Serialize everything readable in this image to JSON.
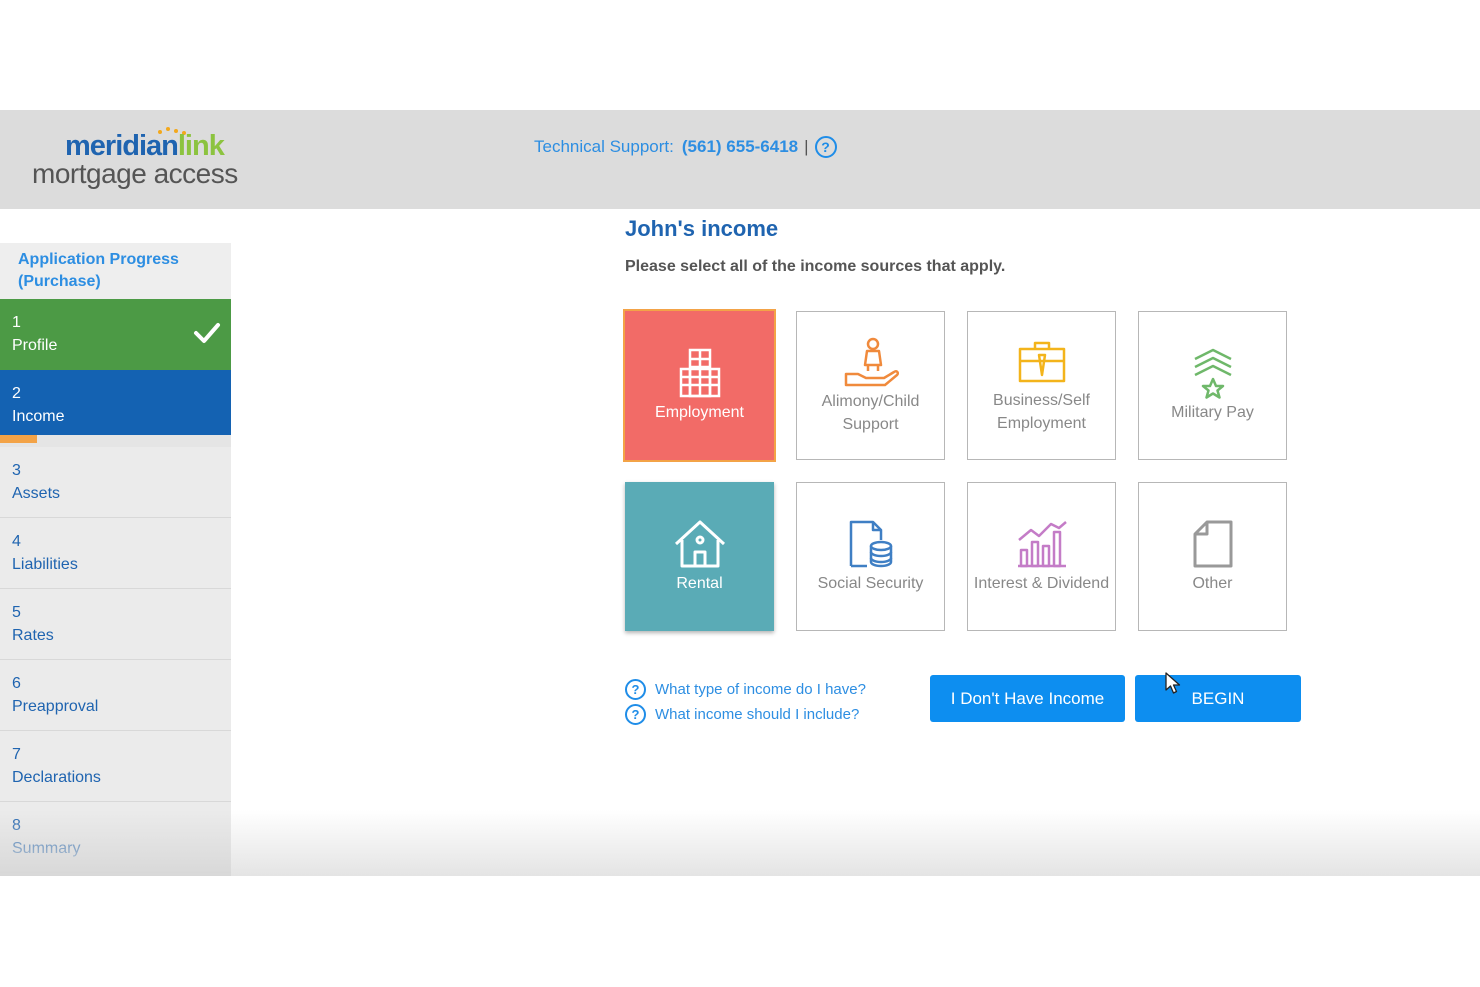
{
  "header": {
    "logo_primary_a": "meridian",
    "logo_primary_b": "link",
    "logo_secondary": "mortgage access",
    "support_label": "Technical Support:",
    "support_phone": "(561) 655-6418",
    "support_separator": "|",
    "help_icon": "question-circle-icon"
  },
  "sidebar": {
    "heading": "Application Progress (Purchase)",
    "steps": [
      {
        "num": "1",
        "label": "Profile",
        "state": "complete"
      },
      {
        "num": "2",
        "label": "Income",
        "state": "active"
      },
      {
        "num": "3",
        "label": "Assets",
        "state": "pending"
      },
      {
        "num": "4",
        "label": "Liabilities",
        "state": "pending"
      },
      {
        "num": "5",
        "label": "Rates",
        "state": "pending"
      },
      {
        "num": "6",
        "label": "Preapproval",
        "state": "pending"
      },
      {
        "num": "7",
        "label": "Declarations",
        "state": "pending"
      },
      {
        "num": "8",
        "label": "Summary",
        "state": "pending"
      }
    ],
    "income_step_progress": 0.16
  },
  "main": {
    "title": "John's income",
    "subtitle": "Please select all of the income sources that apply.",
    "tiles": [
      {
        "label": "Employment",
        "icon": "building-icon",
        "selected": true
      },
      {
        "label": "Alimony/Child Support",
        "icon": "person-hand-icon",
        "selected": false
      },
      {
        "label": "Business/Self Employment",
        "icon": "briefcase-icon",
        "selected": false
      },
      {
        "label": "Military Pay",
        "icon": "chevron-star-icon",
        "selected": false
      },
      {
        "label": "Rental",
        "icon": "house-icon",
        "selected": true
      },
      {
        "label": "Social Security",
        "icon": "document-coins-icon",
        "selected": false
      },
      {
        "label": "Interest & Dividend",
        "icon": "bar-chart-icon",
        "selected": false
      },
      {
        "label": "Other",
        "icon": "document-icon",
        "selected": false
      }
    ],
    "help_links": [
      "What type of income do I have?",
      "What income should I include?"
    ],
    "buttons": {
      "no_income": "I Don't Have Income",
      "begin": "BEGIN"
    }
  },
  "colors": {
    "brand_blue": "#1f64b0",
    "accent_blue": "#0d8ef0",
    "complete_green": "#4c9a45",
    "active_blue": "#1462b2",
    "employment_red": "#f26b67",
    "rental_teal": "#5aabb6",
    "progress_orange": "#f3a347"
  }
}
